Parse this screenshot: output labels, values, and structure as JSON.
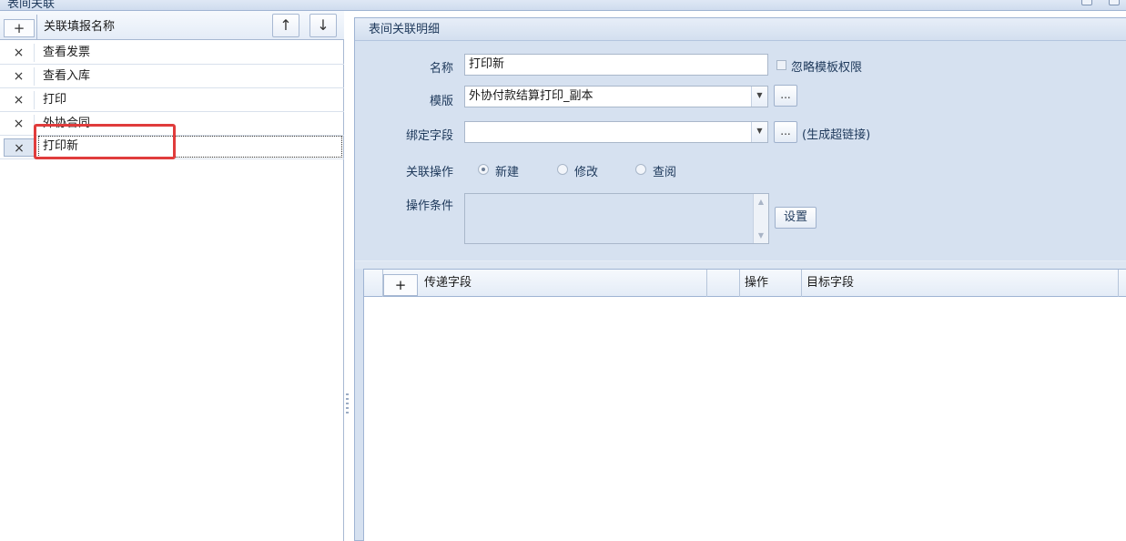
{
  "window": {
    "title": "表间关联"
  },
  "left": {
    "add_label": "+",
    "column_header": "关联填报名称",
    "move_up": "↑",
    "move_down": "↓",
    "delete_label": "×",
    "items": [
      {
        "name": "查看发票"
      },
      {
        "name": "查看入库"
      },
      {
        "name": "打印"
      },
      {
        "name": "外协合同"
      },
      {
        "name": "打印新"
      }
    ]
  },
  "detail": {
    "group_title": "表间关联明细",
    "name_label": "名称",
    "name_value": "打印新",
    "ignore_perm_label": "忽略模板权限",
    "ignore_perm_checked": false,
    "template_label": "模版",
    "template_value": "外协付款结算打印_副本",
    "bind_field_label": "绑定字段",
    "bind_field_value": "",
    "hyperlink_note": "(生成超链接)",
    "ellipsis_label": "...",
    "operation_label": "关联操作",
    "operations": [
      {
        "label": "新建",
        "selected": true
      },
      {
        "label": "修改",
        "selected": false
      },
      {
        "label": "查阅",
        "selected": false
      }
    ],
    "condition_label": "操作条件",
    "condition_value": "",
    "settings_button": "设置"
  },
  "mapping_grid": {
    "add_label": "+",
    "columns": [
      "传递字段",
      "",
      "操作",
      "目标字段"
    ],
    "rows": []
  }
}
